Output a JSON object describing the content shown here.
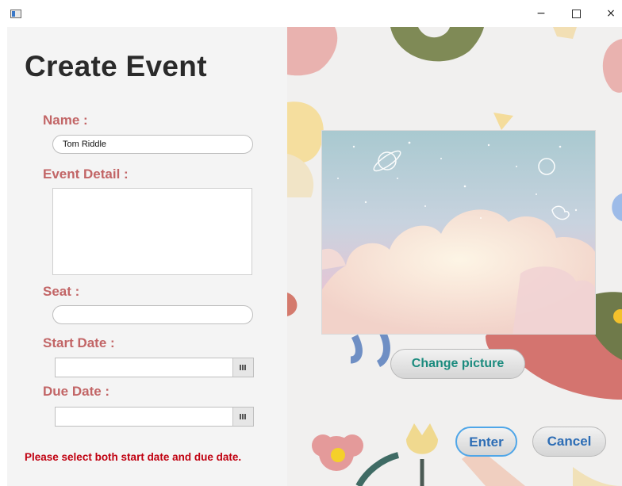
{
  "window": {
    "minimize_glyph": "−",
    "close_glyph": "×"
  },
  "form": {
    "title": "Create Event",
    "name_label": "Name :",
    "name_value": "Tom Riddle",
    "detail_label": "Event Detail :",
    "seat_label": "Seat :",
    "start_date_label": "Start Date :",
    "due_date_label": "Due Date :",
    "error_message": "Please select both start date and due date."
  },
  "picture": {
    "change_label": "Change picture"
  },
  "actions": {
    "enter_label": "Enter",
    "cancel_label": "Cancel"
  },
  "colors": {
    "label": "#c26566",
    "title": "#2a2a2a",
    "error": "#c00010",
    "change_text": "#1b8b7e",
    "action_text": "#2d6db5"
  }
}
